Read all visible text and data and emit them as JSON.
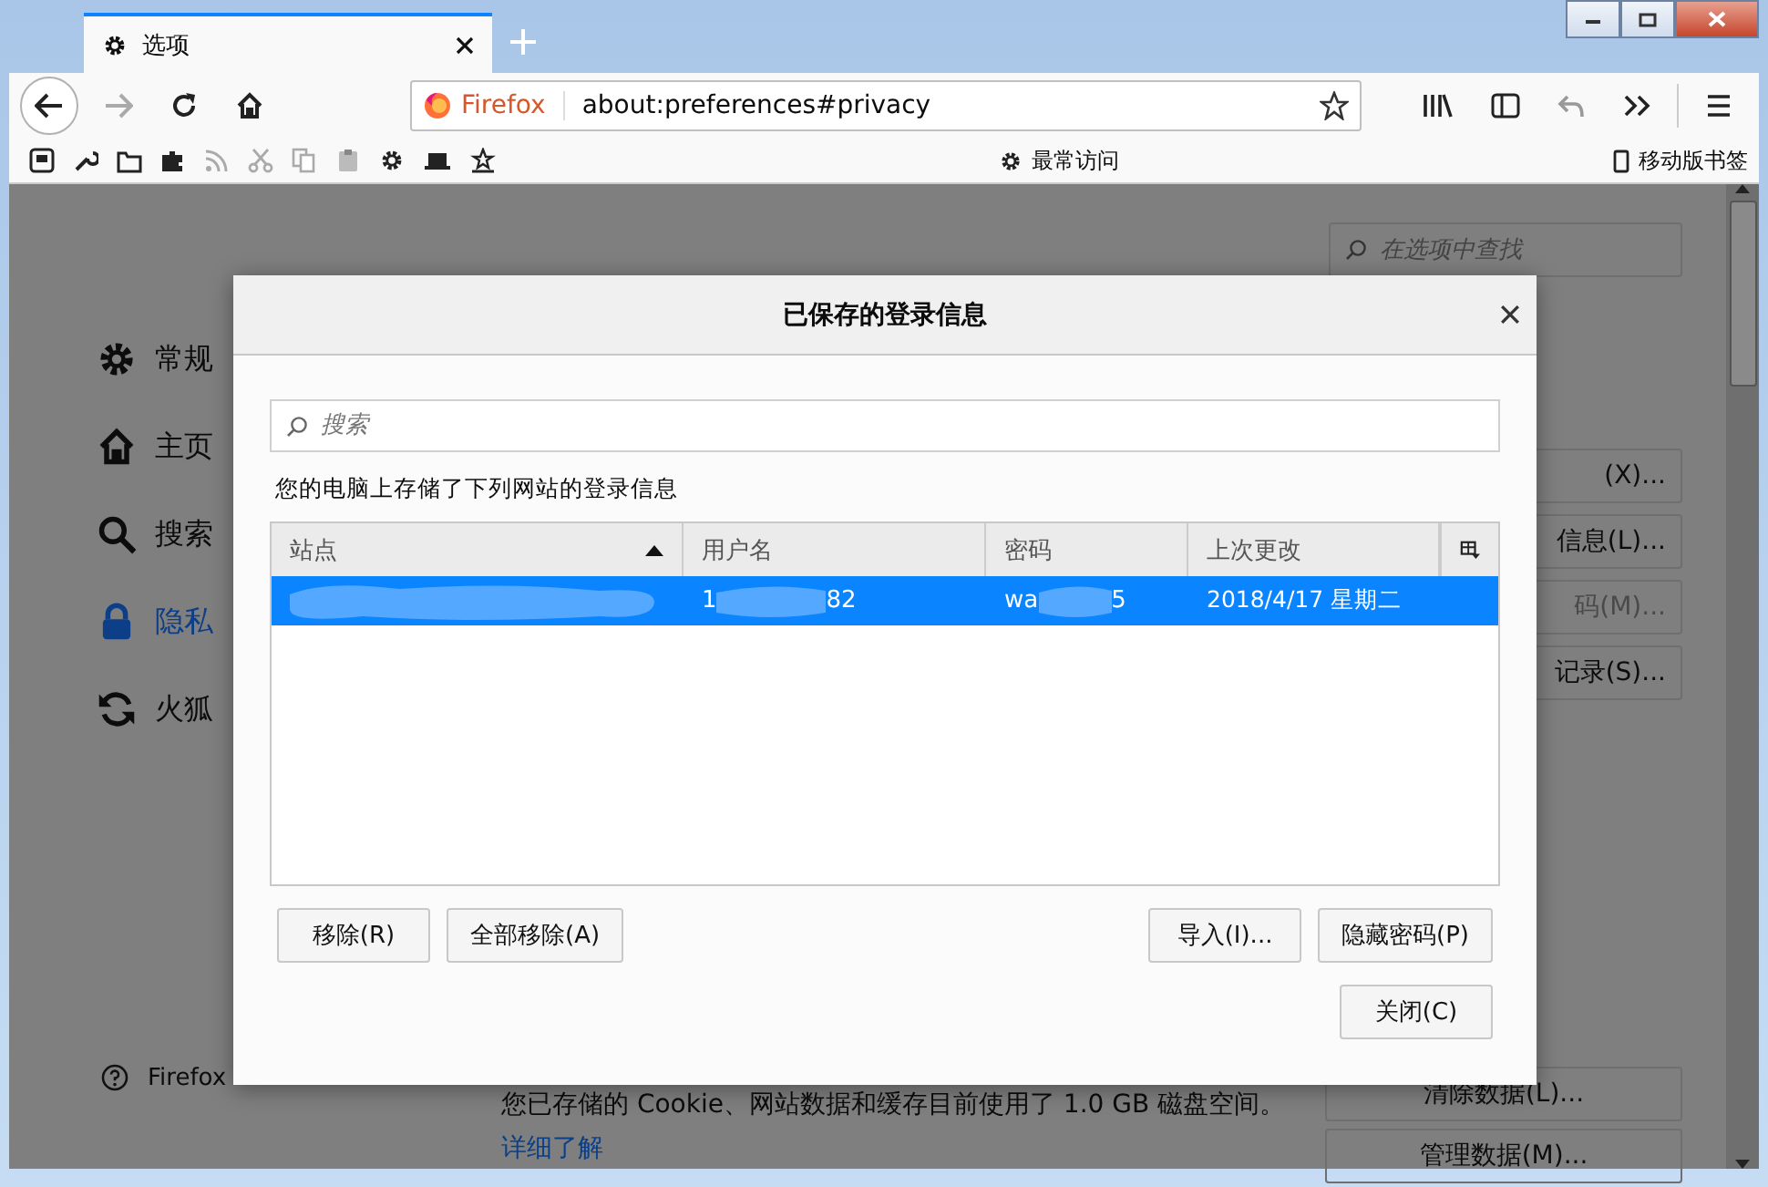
{
  "tabs": [
    {
      "label": "选项",
      "selected": true
    }
  ],
  "address_bar": {
    "identity": "Firefox",
    "url": "about:preferences#privacy"
  },
  "bookmarks_toolbar": {
    "folder": "最常访问",
    "mobile": "移动版书签"
  },
  "preferences": {
    "search_placeholder": "在选项中查找",
    "categories": [
      {
        "label": "常规",
        "selected": false
      },
      {
        "label": "主页",
        "selected": false
      },
      {
        "label": "搜索",
        "selected": false
      },
      {
        "label": "隐私",
        "selected": true
      },
      {
        "label": "火狐",
        "selected": false
      }
    ],
    "support_link": "Firefox",
    "side_buttons": [
      {
        "label": "(X)...",
        "disabled": false
      },
      {
        "label": "信息(L)...",
        "disabled": false
      },
      {
        "label": "码(M)...",
        "disabled": true
      },
      {
        "label": "记录(S)...",
        "disabled": false
      }
    ],
    "storage_note": "您已存储的 Cookie、网站数据和缓存目前使用了 1.0 GB 磁盘空间。",
    "learn_more": "详细了解",
    "storage_buttons": [
      "清除数据(L)...",
      "管理数据(M)..."
    ]
  },
  "dialog": {
    "title": "已保存的登录信息",
    "search_placeholder": "搜索",
    "caption": "您的电脑上存储了下列网站的登录信息",
    "columns": [
      {
        "label": "站点",
        "sorted": true
      },
      {
        "label": "用户名",
        "sorted": false
      },
      {
        "label": "密码",
        "sorted": false
      },
      {
        "label": "上次更改",
        "sorted": false
      }
    ],
    "rows": [
      {
        "selected": true,
        "username_start": "1",
        "username_end": "82",
        "password_start": "wa",
        "password_end": "5",
        "changed": "2018/4/17 星期二"
      }
    ],
    "left_buttons": [
      "移除(R)",
      "全部移除(A)"
    ],
    "right_buttons": [
      "导入(I)...",
      "隐藏密码(P)"
    ],
    "close_button": "关闭(C)"
  }
}
